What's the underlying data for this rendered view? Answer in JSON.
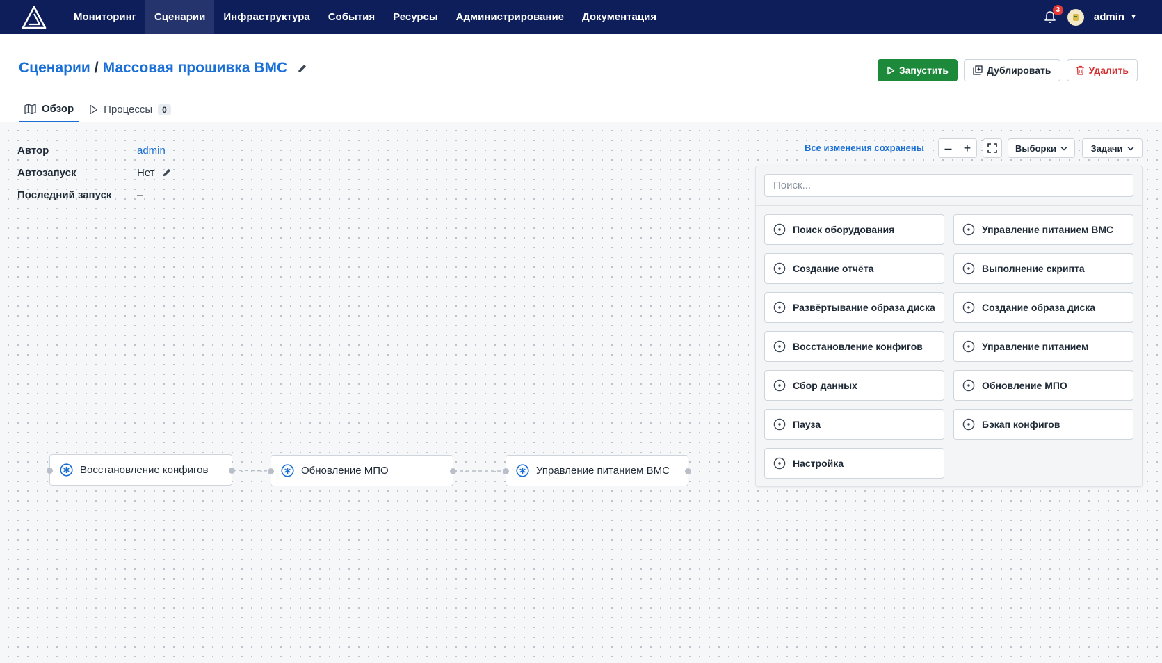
{
  "nav": {
    "items": [
      "Мониторинг",
      "Сценарии",
      "Инфраструктура",
      "События",
      "Ресурсы",
      "Администрирование",
      "Документация"
    ],
    "active_index": 1,
    "notifications_count": "3",
    "user": "admin"
  },
  "header": {
    "breadcrumb_root": "Сценарии",
    "breadcrumb_sep": "/",
    "title": "Массовая прошивка BMC",
    "actions": {
      "run": "Запустить",
      "duplicate": "Дублировать",
      "delete": "Удалить"
    },
    "tabs": [
      {
        "label": "Обзор"
      },
      {
        "label": "Процессы",
        "count": "0"
      }
    ]
  },
  "meta": {
    "author_label": "Автор",
    "author_value": "admin",
    "autorun_label": "Автозапуск",
    "autorun_value": "Нет",
    "last_run_label": "Последний запуск",
    "last_run_value": "–"
  },
  "toolbar": {
    "saved_status": "Все изменения сохранены",
    "zoom_out": "–",
    "zoom_in": "+",
    "selections": "Выборки",
    "tasks": "Задачи"
  },
  "tasks_panel": {
    "search_placeholder": "Поиск...",
    "items": [
      "Поиск оборудования",
      "Управление питанием BMC",
      "Создание отчёта",
      "Выполнение скрипта",
      "Развёртывание образа диска",
      "Создание образа диска",
      "Восстановление конфигов",
      "Управление питанием",
      "Сбор данных",
      "Обновление МПО",
      "Пауза",
      "Бэкап конфигов",
      "Настройка"
    ]
  },
  "workflow": {
    "nodes": [
      "Восстановление конфигов",
      "Обновление МПО",
      "Управление питанием BMC"
    ]
  },
  "colors": {
    "nav_bg": "#0e1e5b",
    "accent": "#1a6fd6",
    "run": "#1c8a3a",
    "danger": "#d32f2f"
  }
}
